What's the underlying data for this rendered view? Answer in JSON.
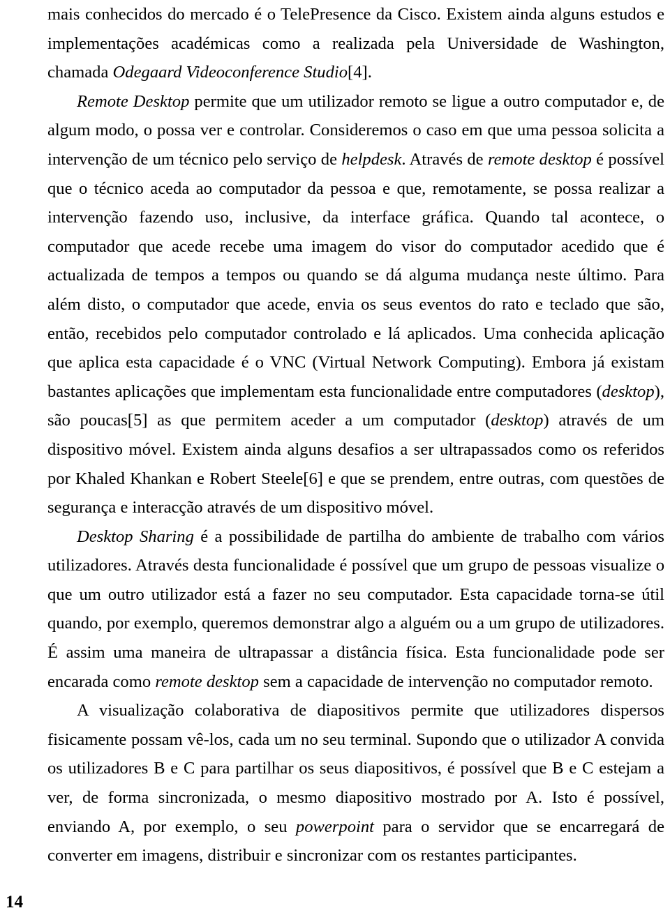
{
  "document": {
    "page_number": "14",
    "language": "pt-PT",
    "paragraphs": [
      {
        "id": "p1",
        "indent": false,
        "runs": [
          {
            "style": "normal",
            "text": "mais conhecidos do mercado é o TelePresence da Cisco. Existem ainda alguns estudos e implementações académicas como a realizada pela Universidade de Washington, chamada "
          },
          {
            "style": "italic",
            "text": "Odegaard Videoconference Studio"
          },
          {
            "style": "normal",
            "text": "[4]."
          }
        ]
      },
      {
        "id": "p2",
        "indent": true,
        "runs": [
          {
            "style": "italic",
            "text": "Remote Desktop"
          },
          {
            "style": "normal",
            "text": " permite que um utilizador remoto se ligue a outro computador e, de algum modo, o possa ver e controlar. Consideremos o caso em que uma pessoa solicita a intervenção de um técnico pelo serviço de "
          },
          {
            "style": "italic",
            "text": "helpdesk"
          },
          {
            "style": "normal",
            "text": ". Através de "
          },
          {
            "style": "italic",
            "text": "remote desktop"
          },
          {
            "style": "normal",
            "text": " é possível que o técnico aceda ao computador da pessoa e que, remotamente, se possa realizar a intervenção fazendo uso, inclusive, da interface gráfica. Quando tal acontece, o computador que acede recebe uma imagem do visor do computador acedido que é actualizada de tempos a tempos ou quando se dá alguma mudança neste último. Para além disto, o computador que acede, envia os seus eventos do rato e teclado que são, então, recebidos pelo computador controlado e lá aplicados. Uma conhecida aplicação que aplica esta capacidade é o VNC (Virtual Network Computing). Embora já existam bastantes aplicações que implementam esta funcionalidade entre computadores ("
          },
          {
            "style": "italic",
            "text": "desktop"
          },
          {
            "style": "normal",
            "text": "), são poucas[5] as que permitem aceder a um computador ("
          },
          {
            "style": "italic",
            "text": "desktop"
          },
          {
            "style": "normal",
            "text": ") através de um dispositivo móvel. Existem ainda alguns desafios a ser ultrapassados como os referidos por Khaled Khankan e Robert Steele[6] e que se prendem, entre outras, com questões de segurança e interacção através de um dispositivo móvel."
          }
        ]
      },
      {
        "id": "p3",
        "indent": true,
        "runs": [
          {
            "style": "italic",
            "text": "Desktop Sharing"
          },
          {
            "style": "normal",
            "text": " é a possibilidade de partilha do ambiente de trabalho com vários utilizadores. Através desta funcionalidade é possível que um grupo de pessoas visualize o que um outro utilizador está a fazer no seu computador. Esta capacidade torna-se útil quando, por exemplo, queremos demonstrar algo a alguém ou a um grupo de utilizadores. É assim uma maneira de ultrapassar a distância física. Esta funcionalidade pode ser encarada como "
          },
          {
            "style": "italic",
            "text": "remote desktop"
          },
          {
            "style": "normal",
            "text": " sem a capacidade de intervenção no computador remoto."
          }
        ]
      },
      {
        "id": "p4",
        "indent": true,
        "runs": [
          {
            "style": "normal",
            "text": "A visualização colaborativa de diapositivos permite que utilizadores dispersos fisicamente possam vê-los, cada um no seu terminal. Supondo que o utilizador A convida os utilizadores B e C para partilhar os seus diapositivos, é possível que B e C estejam a ver, de forma sincronizada, o mesmo diapositivo mostrado por A. Isto é possível, enviando A, por exemplo, o seu "
          },
          {
            "style": "italic",
            "text": "powerpoint"
          },
          {
            "style": "normal",
            "text": " para o servidor que se encarregará de converter em imagens, distribuir e sincronizar com os restantes participantes."
          }
        ]
      }
    ]
  }
}
